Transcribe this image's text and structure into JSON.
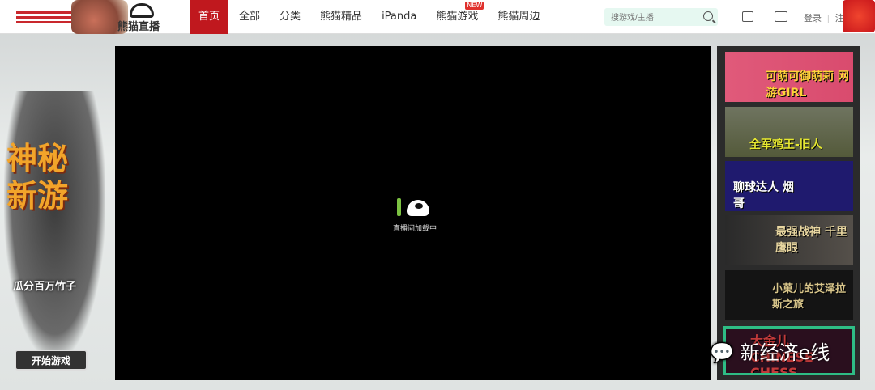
{
  "header": {
    "brand": "熊猫直播",
    "nav": [
      {
        "label": "首页",
        "active": true
      },
      {
        "label": "全部"
      },
      {
        "label": "分类"
      },
      {
        "label": "熊猫精品"
      },
      {
        "label": "iPanda"
      },
      {
        "label": "熊猫游戏",
        "badge": "NEW"
      },
      {
        "label": "熊猫周边"
      }
    ],
    "search_placeholder": "搜游戏/主播",
    "login": "登录",
    "register": "注册",
    "accent": "#c0181e"
  },
  "ad": {
    "title": "神秘新游",
    "subtitle": "瓜分百万竹子",
    "play_button": "开始游戏"
  },
  "player": {
    "loading_text": "直播间加载中"
  },
  "sidebar": {
    "banners": [
      "可萌可御萌莉 网游GIRL",
      "全军鸡王-旧人",
      "聊球达人 烟哥",
      "最强战神 千里鹰眼",
      "小菓儿的艾泽拉斯之旅",
      "大金儿 CHINESE CHESS"
    ]
  },
  "watermark": "新经济e线"
}
